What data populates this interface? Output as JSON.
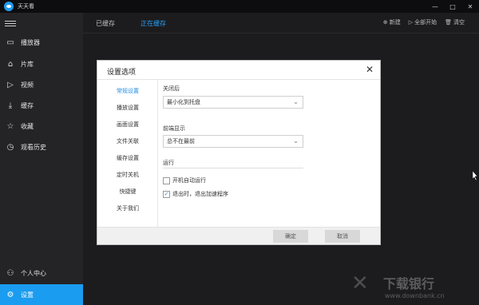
{
  "app": {
    "title": "天天看",
    "logo_icon": "eye-logo-icon"
  },
  "window_controls": {
    "minimize": "—",
    "maximize": "□",
    "close": "✕"
  },
  "sidebar": {
    "items": [
      {
        "label": "播放器",
        "icon": "▭"
      },
      {
        "label": "片库",
        "icon": "⌂"
      },
      {
        "label": "视频",
        "icon": "▷"
      },
      {
        "label": "缓存",
        "icon": "⤓"
      },
      {
        "label": "收藏",
        "icon": "☆"
      },
      {
        "label": "观看历史",
        "icon": "◷"
      }
    ],
    "bottom": [
      {
        "label": "个人中心",
        "icon": "⚇"
      },
      {
        "label": "设置",
        "icon": "⚙"
      }
    ],
    "active_color": "#1a9cf0"
  },
  "tabs": {
    "cached": "已缓存",
    "caching": "正在缓存"
  },
  "top_actions": {
    "new": "新建",
    "start_all": "全部开始",
    "clear": "清空"
  },
  "dialog": {
    "title": "设置选项",
    "nav": [
      "常规设置",
      "播放设置",
      "画面设置",
      "文件关联",
      "缓存设置",
      "定时关机",
      "快捷键",
      "关于我们"
    ],
    "after_close_label": "关闭后",
    "after_close_value": "最小化到托盘",
    "front_display_label": "前端显示",
    "front_display_value": "总不在最前",
    "run_label": "运行",
    "auto_start_label": "开机自动运行",
    "auto_start_checked": false,
    "exit_label": "退出时，退出加速程序",
    "exit_checked": true,
    "ok_button": "确定",
    "cancel_button": "取消",
    "accent_color": "#2a8fe0"
  },
  "watermark": {
    "brand": "下载银行",
    "url": "www.downbank.cn"
  }
}
